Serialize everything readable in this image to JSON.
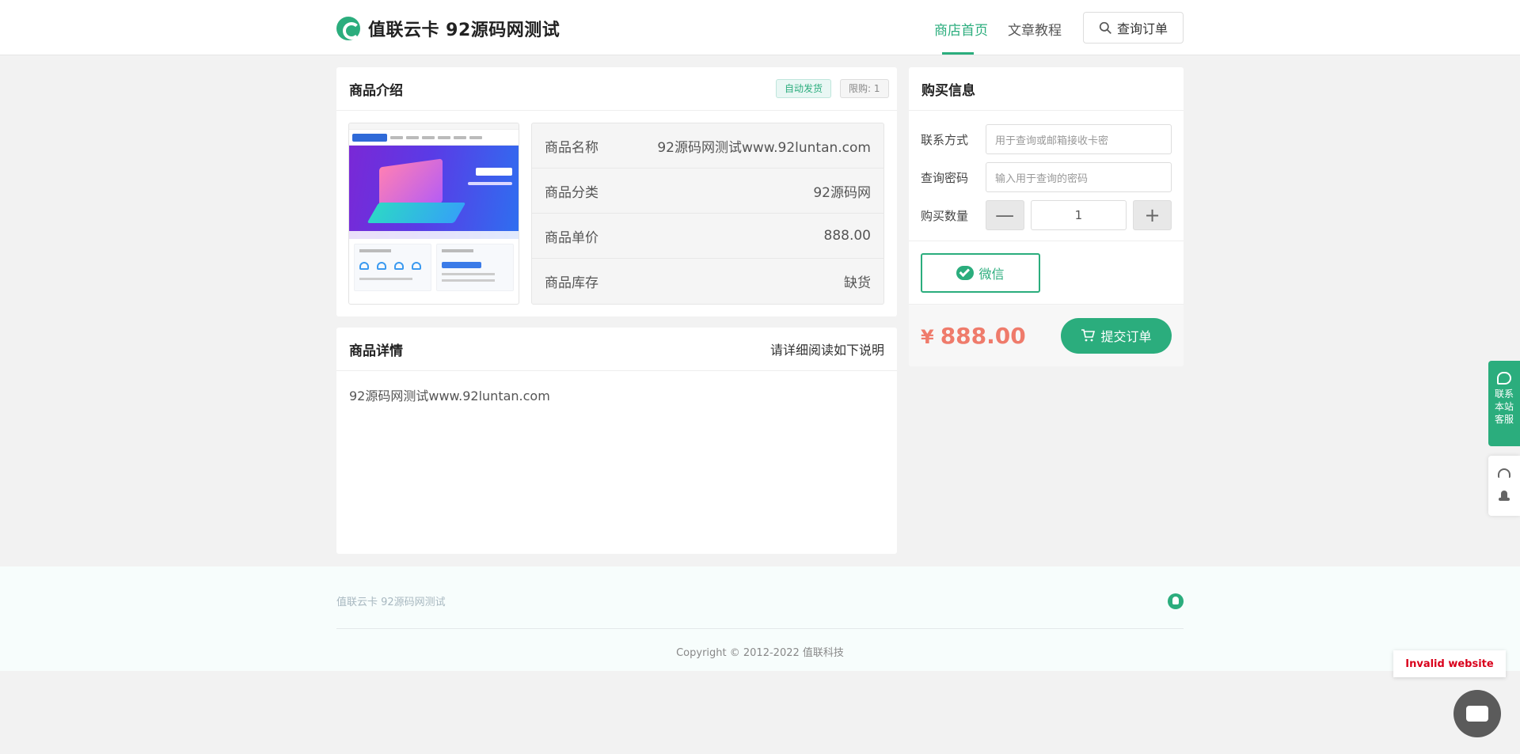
{
  "header": {
    "logo_text": "值联云卡 92源码网测试",
    "nav": {
      "home": "商店首页",
      "article": "文章教程",
      "query": "查询订单"
    }
  },
  "intro": {
    "title": "商品介绍",
    "badge_auto": "自动发货",
    "badge_limit": "限购: 1",
    "rows": [
      {
        "label": "商品名称",
        "value": "92源码网测试www.92luntan.com"
      },
      {
        "label": "商品分类",
        "value": "92源码网"
      },
      {
        "label": "商品单价",
        "value": "888.00"
      },
      {
        "label": "商品库存",
        "value": "缺货"
      }
    ]
  },
  "detail": {
    "title": "商品详情",
    "note": "请详细阅读如下说明",
    "content": "92源码网测试www.92luntan.com"
  },
  "buy": {
    "title": "购买信息",
    "contact_label": "联系方式",
    "contact_placeholder": "用于查询或邮箱接收卡密",
    "password_label": "查询密码",
    "password_placeholder": "输入用于查询的密码",
    "qty_label": "购买数量",
    "qty_minus": "—",
    "qty_value": "1",
    "qty_plus": "+",
    "pay_method": "微信",
    "currency": "¥",
    "price": "888.00",
    "submit": "提交订单"
  },
  "footer": {
    "brand": "值联云卡 92源码网测试",
    "copyright": "Copyright © 2012-2022 值联科技"
  },
  "side": {
    "cs_lines": [
      "联系",
      "本站",
      "客服"
    ]
  },
  "notice": {
    "invalid": "Invalid website"
  },
  "colors": {
    "accent": "#2bad7d",
    "price": "#ef7b6b",
    "invalid": "#d9001b"
  }
}
